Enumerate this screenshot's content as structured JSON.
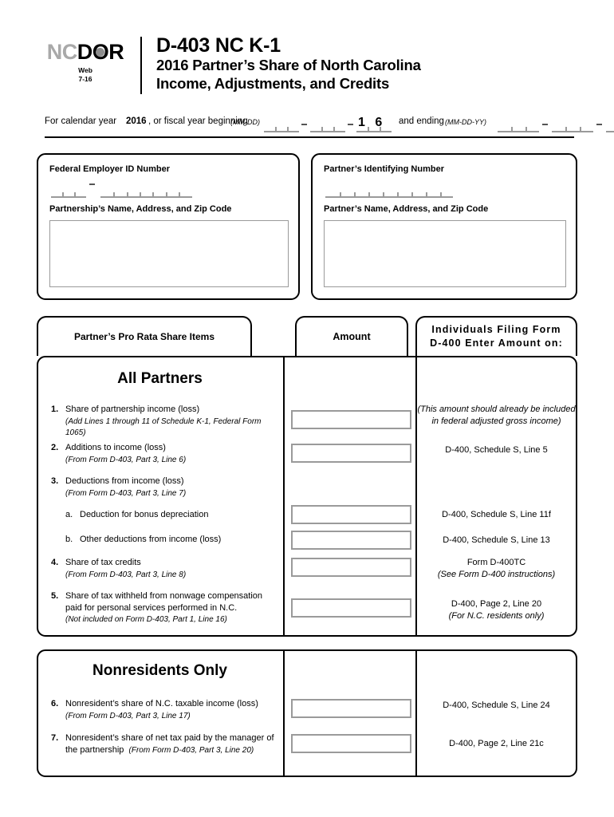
{
  "logo": {
    "nc": "NC",
    "d": "D",
    "o": "O",
    "r": "R",
    "web_label": "Web",
    "revision": "7-16"
  },
  "header": {
    "form_number": "D-403 NC K-1",
    "title_line_1": "2016 Partner’s Share of North Carolina",
    "title_line_2": "Income, Adjustments, and Credits"
  },
  "year_line": {
    "prefix": "For calendar year",
    "year": "2016",
    "middle": ", or fiscal year beginning",
    "begin_format": "(MM-DD)",
    "year_digits": "1 6",
    "and_ending": "and ending",
    "end_format": "(MM-DD-YY)"
  },
  "identification": {
    "partnership": {
      "id_label": "Federal Employer ID Number",
      "name_label": "Partnership’s Name, Address, and Zip Code",
      "id_value": "",
      "address_value": ""
    },
    "partner": {
      "id_label": "Partner’s Identifying Number",
      "name_label": "Partner’s Name, Address, and Zip Code",
      "id_value": "",
      "address_value": ""
    }
  },
  "columns": {
    "items": "Partner’s Pro Rata Share Items",
    "amount": "Amount",
    "enter_on_line_1": "Individuals Filing Form",
    "enter_on_line_2": "D-400 Enter Amount on:"
  },
  "sections": {
    "all_partners": {
      "title": "All Partners",
      "rows": [
        {
          "number": "1.",
          "text": "Share of partnership income (loss)",
          "note": "(Add Lines 1 through 11 of Schedule K-1, Federal Form 1065)",
          "amount": "",
          "ref_italic": "(This amount should already be included in federal adjusted gross income)",
          "ref": ""
        },
        {
          "number": "2.",
          "text": "Additions to income (loss)",
          "note": "(From Form D-403, Part 3, Line 6)",
          "amount": "",
          "ref_italic": "",
          "ref": "D-400, Schedule S, Line 5"
        },
        {
          "number": "3.",
          "text": "Deductions from income (loss)",
          "note": "(From Form D-403, Part 3, Line 7)",
          "amount": null,
          "ref_italic": "",
          "ref": ""
        },
        {
          "number": "a.",
          "text": "Deduction for bonus depreciation",
          "note": "",
          "amount": "",
          "ref_italic": "",
          "ref": "D-400, Schedule S, Line 11f"
        },
        {
          "number": "b.",
          "text": "Other deductions from income (loss)",
          "note": "",
          "amount": "",
          "ref_italic": "",
          "ref": "D-400, Schedule S, Line 13"
        },
        {
          "number": "4.",
          "text": "Share of tax credits",
          "note": "(From Form D-403, Part 3, Line 8)",
          "amount": "",
          "ref_italic": "(See Form D-400 instructions)",
          "ref": "Form D-400TC"
        },
        {
          "number": "5.",
          "text": "Share of tax withheld from nonwage compensation paid for personal services performed in N.C.",
          "note": "(Not included on Form D-403, Part 1, Line 16)",
          "amount": "",
          "ref_italic": "(For N.C. residents only)",
          "ref": "D-400, Page 2, Line 20"
        }
      ]
    },
    "nonresidents": {
      "title": "Nonresidents Only",
      "rows": [
        {
          "number": "6.",
          "text": "Nonresident’s share of N.C. taxable income (loss)",
          "note": "(From Form D-403, Part 3, Line 17)",
          "amount": "",
          "ref": "D-400, Schedule S, Line 24"
        },
        {
          "number": "7.",
          "text": "Nonresident’s share of net tax paid by the manager of the partnership",
          "note": "(From Form D-403, Part 3, Line 20)",
          "amount": "",
          "ref": "D-400, Page 2, Line 21c"
        }
      ]
    }
  }
}
